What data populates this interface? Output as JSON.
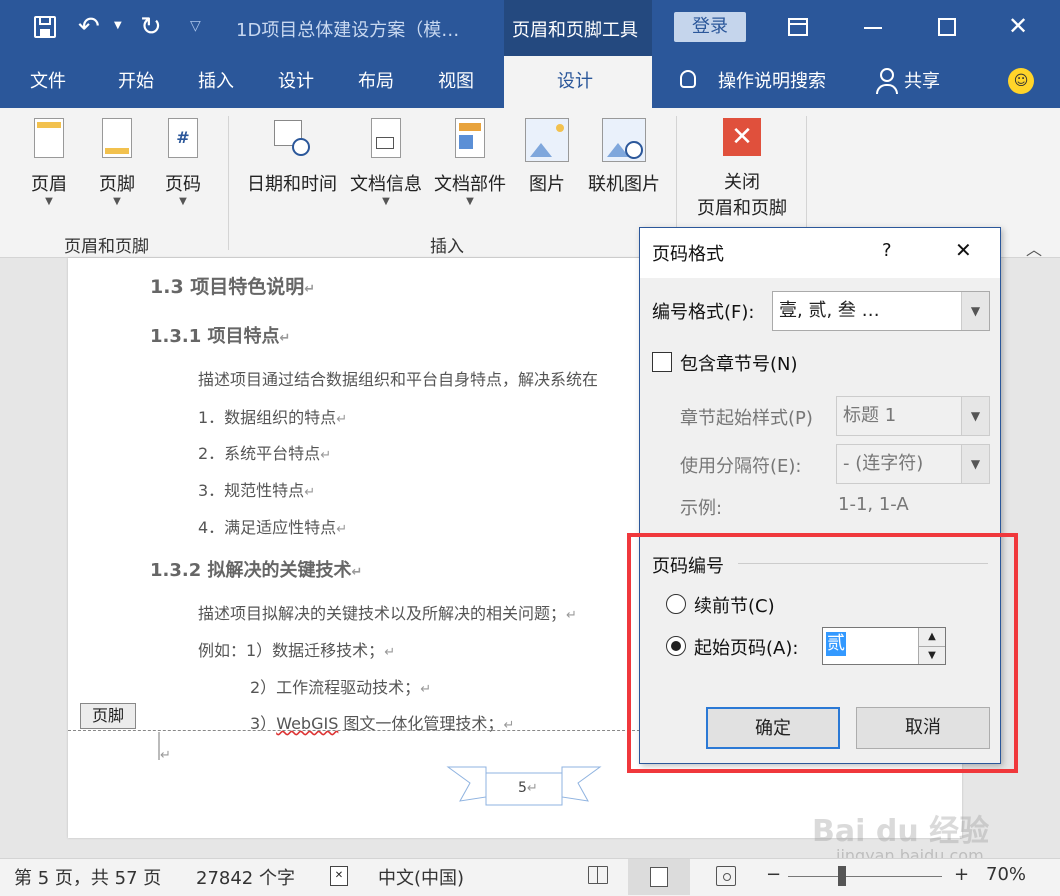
{
  "titlebar": {
    "doc_title": "1D项目总体建设方案（模…",
    "context_tab": "页眉和页脚工具",
    "login_label": "登录"
  },
  "tabs": [
    "文件",
    "开始",
    "插入",
    "设计",
    "布局",
    "视图",
    "设计"
  ],
  "search_label": "操作说明搜索",
  "share_label": "共享",
  "ribbon": {
    "header": "页眉",
    "footer": "页脚",
    "page_number": "页码",
    "datetime": "日期和时间",
    "docinfo": "文档信息",
    "quickparts": "文档部件",
    "picture": "图片",
    "online_picture": "联机图片",
    "close_line1": "关闭",
    "close_line2": "页眉和页脚",
    "group1": "页眉和页脚",
    "group2": "插入"
  },
  "doc": {
    "h13": "1.3  项目特色说明",
    "h131": "1.3.1  项目特点",
    "p1": "描述项目通过结合数据组织和平台自身特点，解决系统在",
    "li1": "1．数据组织的特点",
    "li2": "2．系统平台特点",
    "li3": "3．规范性特点",
    "li4": "4．满足适应性特点",
    "h132": "1.3.2  拟解决的关键技术",
    "p2": "描述项目拟解决的关键技术以及所解决的相关问题；",
    "p3": "例如：1）数据迁移技术；",
    "p4": "2）工作流程驱动技术；",
    "p5a": "3）",
    "p5b": "WebGIS",
    "p5c": " 图文一体化管理技术；",
    "footer_tag": "页脚",
    "page_no": "5"
  },
  "dialog": {
    "title": "页码格式",
    "help": "?",
    "close": "✕",
    "format_label": "编号格式(F):",
    "format_value": "壹, 贰, 叁 …",
    "include_chapter": "包含章节号(N)",
    "chapter_style_label": "章节起始样式(P)",
    "chapter_style_value": "标题 1",
    "separator_label": "使用分隔符(E):",
    "separator_value": "-  (连字符)",
    "example_label": "示例:",
    "example_value": "1-1, 1-A",
    "numbering_group": "页码编号",
    "continue_label": "续前节(C)",
    "start_label": "起始页码(A):",
    "start_value": "贰",
    "ok": "确定",
    "cancel": "取消"
  },
  "status": {
    "page": "第 5 页，共 57 页",
    "words": "27842 个字",
    "lang": "中文(中国)",
    "zoom": "70%",
    "minus": "−",
    "plus": "+"
  },
  "watermark": {
    "line1": "Bai du 经验",
    "line2": "jingyan.baidu.com"
  }
}
